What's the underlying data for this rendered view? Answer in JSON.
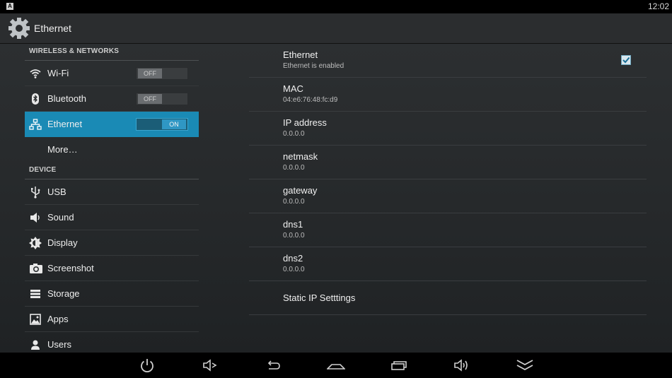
{
  "status": {
    "app_badge": "A",
    "time": "12:02"
  },
  "actionbar": {
    "title": "Ethernet",
    "icon": "settings-gear-icon"
  },
  "sidebar": {
    "sections": [
      {
        "header": "WIRELESS & NETWORKS"
      },
      {
        "header": "DEVICE"
      }
    ],
    "wireless": [
      {
        "label": "Wi-Fi",
        "icon": "wifi-icon",
        "toggle": "OFF"
      },
      {
        "label": "Bluetooth",
        "icon": "bluetooth-icon",
        "toggle": "OFF"
      },
      {
        "label": "Ethernet",
        "icon": "ethernet-icon",
        "toggle": "ON",
        "selected": true
      },
      {
        "label": "More…"
      }
    ],
    "device": [
      {
        "label": "USB",
        "icon": "usb-icon"
      },
      {
        "label": "Sound",
        "icon": "speaker-icon"
      },
      {
        "label": "Display",
        "icon": "brightness-icon"
      },
      {
        "label": "Screenshot",
        "icon": "camera-icon"
      },
      {
        "label": "Storage",
        "icon": "storage-icon"
      },
      {
        "label": "Apps",
        "icon": "apps-icon"
      },
      {
        "label": "Users",
        "icon": "user-icon"
      }
    ]
  },
  "detail": {
    "items": [
      {
        "title": "Ethernet",
        "summary": "Ethernet is enabled",
        "checked": true
      },
      {
        "title": "MAC",
        "summary": "04:e6:76:48:fc:d9"
      },
      {
        "title": "IP address",
        "summary": "0.0.0.0"
      },
      {
        "title": "netmask",
        "summary": "0.0.0.0"
      },
      {
        "title": "gateway",
        "summary": "0.0.0.0"
      },
      {
        "title": "dns1",
        "summary": "0.0.0.0"
      },
      {
        "title": "dns2",
        "summary": "0.0.0.0"
      },
      {
        "title": "Static IP Setttings"
      }
    ]
  },
  "navbar": {
    "buttons": [
      "power-icon",
      "volume-down-icon",
      "back-icon",
      "home-icon",
      "recent-apps-icon",
      "volume-up-icon",
      "hide-bar-icon"
    ]
  },
  "colors": {
    "accent": "#1a8ab5",
    "background": "#2c2f31"
  }
}
